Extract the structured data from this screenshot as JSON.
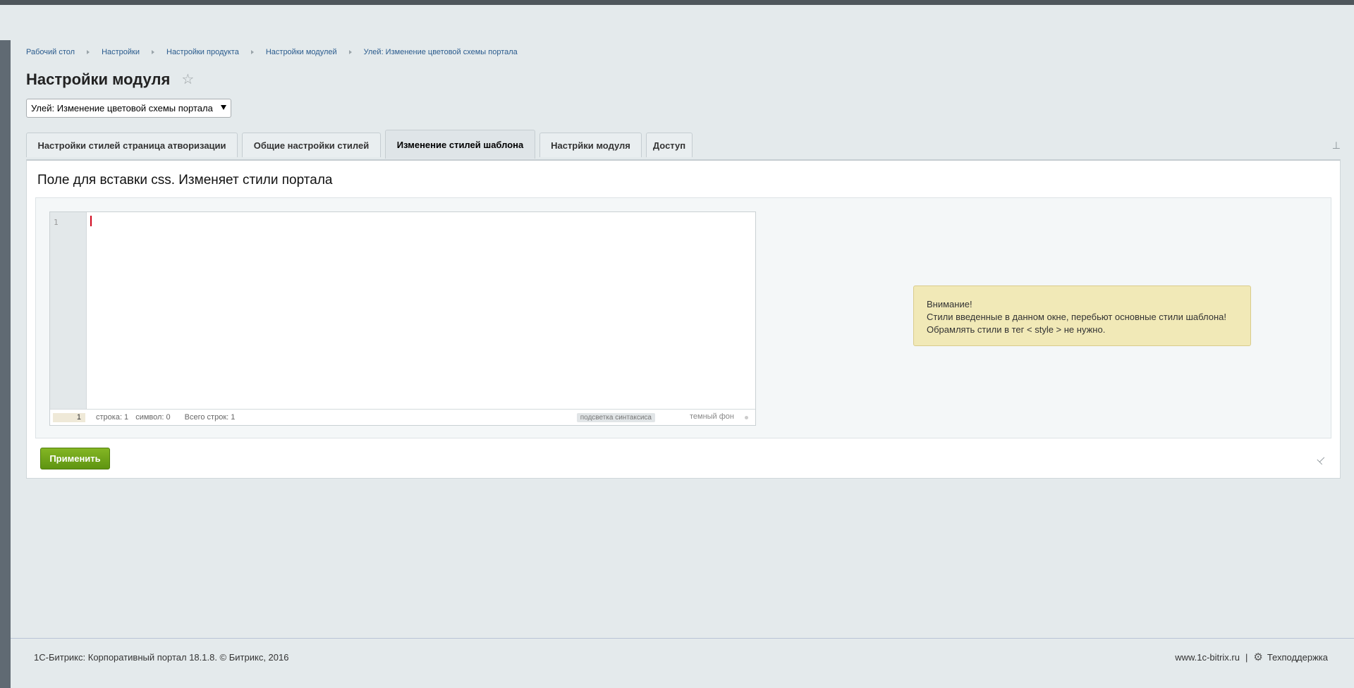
{
  "breadcrumbs": [
    {
      "label": "Рабочий стол"
    },
    {
      "label": "Настройки"
    },
    {
      "label": "Настройки продукта"
    },
    {
      "label": "Настройки модулей"
    },
    {
      "label": "Улей: Изменение цветовой схемы портала"
    }
  ],
  "page": {
    "title": "Настройки модуля",
    "favorite_icon": "star-icon"
  },
  "module_select": {
    "selected": "Улей: Изменение цветовой схемы портала"
  },
  "tabs": [
    {
      "label": "Настройки стилей страница атворизации"
    },
    {
      "label": "Общие настройки стилей"
    },
    {
      "label": "Изменение стилей шаблона",
      "active": true
    },
    {
      "label": "Настрйки модуля"
    },
    {
      "label": "Доступ"
    }
  ],
  "panel": {
    "heading": "Поле для вставки css. Изменяет стили портала"
  },
  "editor": {
    "line_number": "1",
    "status_line_value": "1",
    "position": "строка: 1",
    "char": "символ: 0",
    "total": "Всего строк: 1",
    "syntax_label": "подсветка синтаксиса",
    "dark_label": "темный фон"
  },
  "notice": {
    "line1": "Внимание!",
    "line2": "Стили введенные в данном окне, перебьют основные стили шаблона!",
    "line3": "Обрамлять стили в тег < style > не нужно."
  },
  "actions": {
    "apply_label": "Применить"
  },
  "footer": {
    "copyright": "1С-Битрикс: Корпоративный портал 18.1.8. © Битрикс, 2016",
    "site": "www.1c-bitrix.ru",
    "divider": "|",
    "support": "Техподдержка"
  },
  "colors": {
    "background": "#e4eaec",
    "link": "#2a5b8d",
    "apply_green": "#6ca51a",
    "notice_yellow": "#f1e9b7"
  }
}
